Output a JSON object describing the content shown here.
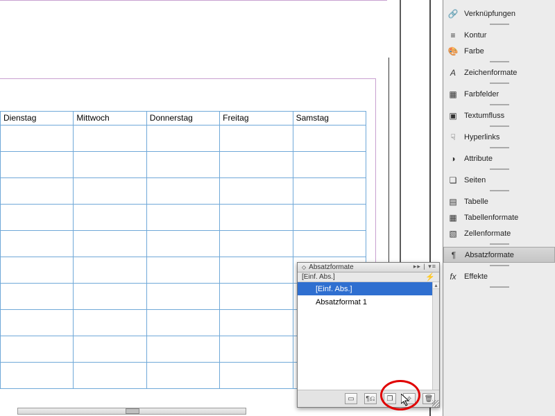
{
  "days": [
    "Dienstag",
    "Mittwoch",
    "Donnerstag",
    "Freitag",
    "Samstag"
  ],
  "panels": {
    "verknuepfungen": "Verknüpfungen",
    "kontur": "Kontur",
    "farbe": "Farbe",
    "zeichenformate": "Zeichenformate",
    "farbfelder": "Farbfelder",
    "textumfluss": "Textumfluss",
    "hyperlinks": "Hyperlinks",
    "attribute": "Attribute",
    "seiten": "Seiten",
    "tabelle": "Tabelle",
    "tabellenformate": "Tabellenformate",
    "zellenformate": "Zellenformate",
    "absatzformate": "Absatzformate",
    "effekte": "Effekte"
  },
  "absatz_panel": {
    "title": "Absatzformate",
    "current": "[Einf. Abs.]",
    "items": [
      "[Einf. Abs.]",
      "Absatzformat 1"
    ],
    "selected_index": 0
  }
}
